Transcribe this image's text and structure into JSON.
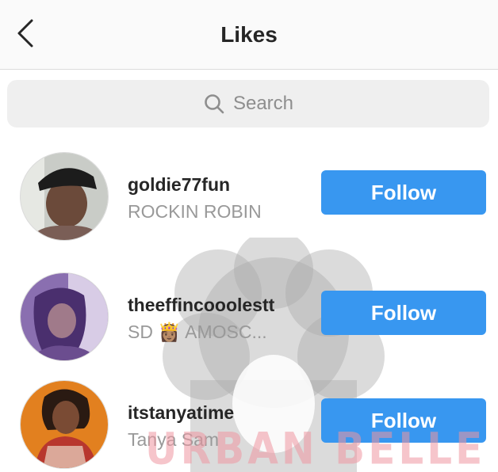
{
  "header": {
    "title": "Likes",
    "back_icon": "chevron-left-icon"
  },
  "search": {
    "placeholder": "Search",
    "icon": "search-icon"
  },
  "likes": [
    {
      "username": "goldie77fun",
      "full_name": "ROCKIN ROBIN",
      "follow_label": "Follow"
    },
    {
      "username": "theeffincooolestt",
      "full_name": "SD 👸🏽 AMOSC...",
      "follow_label": "Follow"
    },
    {
      "username": "itstanyatime",
      "full_name": "Tanya Sam",
      "follow_label": "Follow"
    }
  ],
  "watermark": {
    "text": "URBAN BELLE"
  },
  "colors": {
    "follow_button": "#3897f0",
    "navbar_bg": "#fafafa",
    "search_bg": "#efefef",
    "secondary_text": "#999999"
  }
}
